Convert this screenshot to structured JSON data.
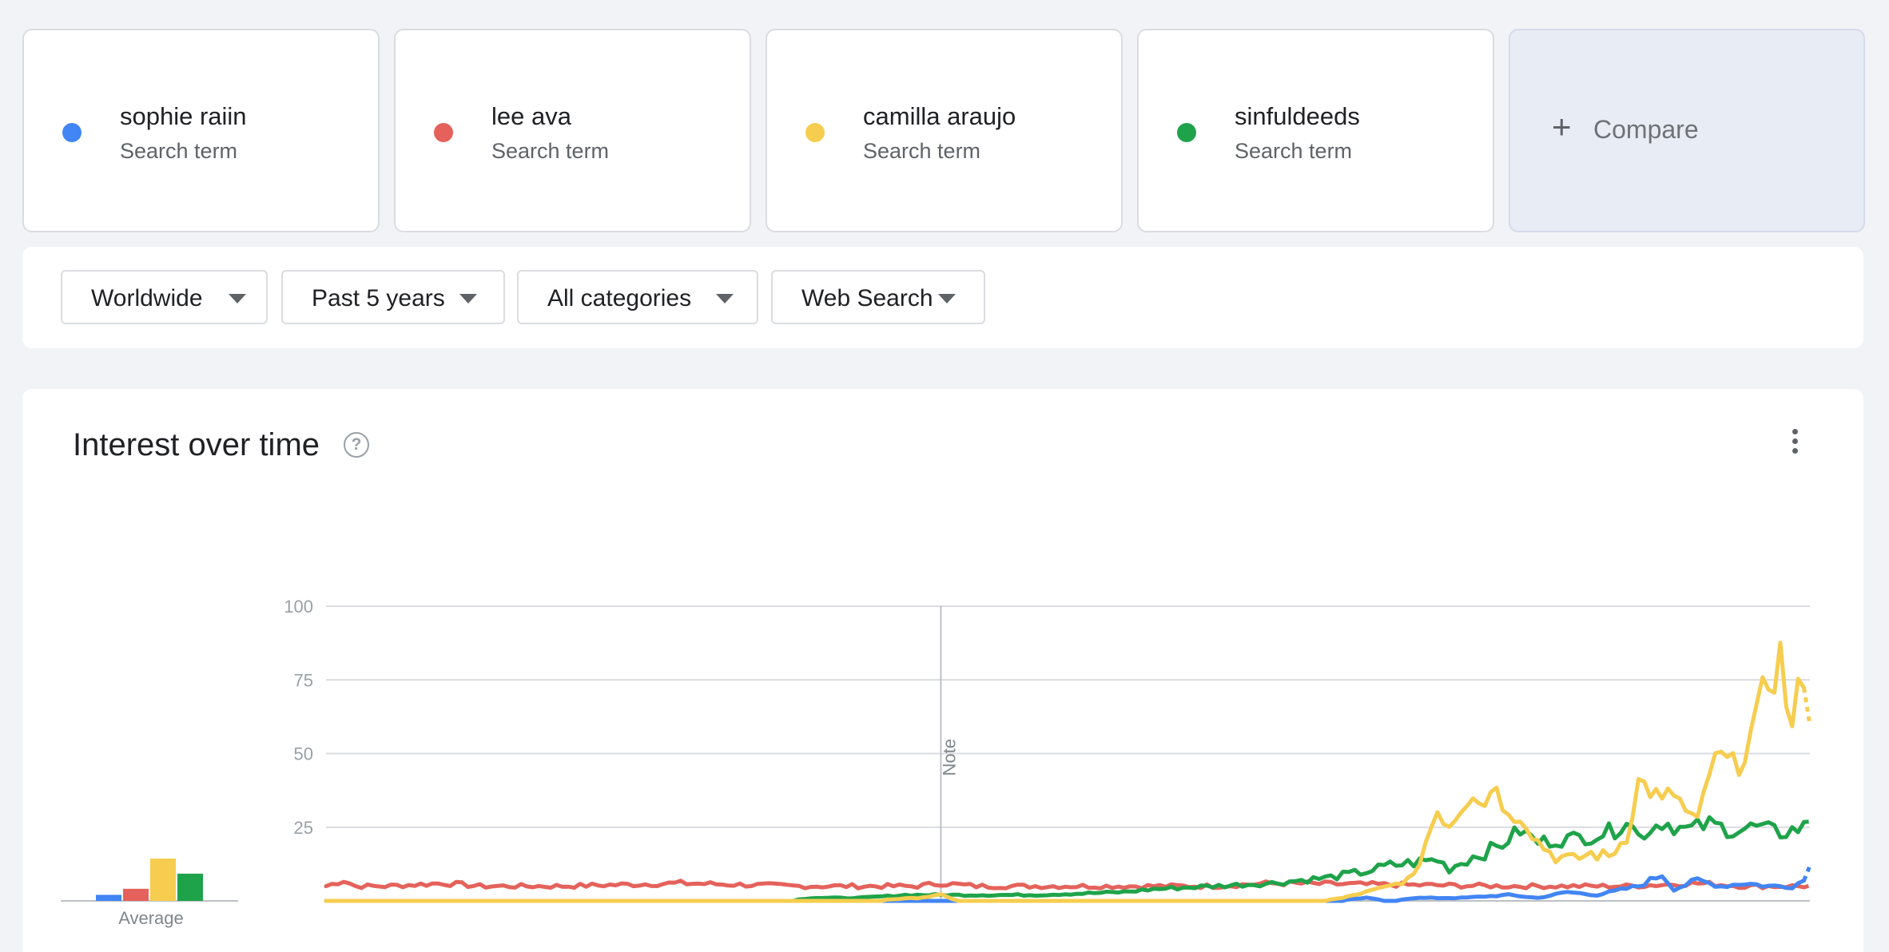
{
  "terms": [
    {
      "name": "sophie raiin",
      "subtitle": "Search term",
      "color": "#4285f4"
    },
    {
      "name": "lee ava",
      "subtitle": "Search term",
      "color": "#e4625b"
    },
    {
      "name": "camilla araujo",
      "subtitle": "Search term",
      "color": "#f6cd4f"
    },
    {
      "name": "sinfuldeeds",
      "subtitle": "Search term",
      "color": "#1fa34a"
    }
  ],
  "compare": {
    "icon": "plus-icon",
    "label": "Compare"
  },
  "filters": [
    {
      "label": "Worldwide"
    },
    {
      "label": "Past 5 years"
    },
    {
      "label": "All categories"
    },
    {
      "label": "Web Search"
    }
  ],
  "panel": {
    "title": "Interest over time",
    "help_icon": "?",
    "menu_icon": "more-vert-icon",
    "average_label": "Average",
    "note_label": "Note"
  },
  "chart_data": {
    "type": "line",
    "title": "",
    "xlabel": "",
    "ylabel": "",
    "ylim": [
      0,
      100
    ],
    "yticks": [
      25,
      50,
      75,
      100
    ],
    "ytick_labels": [
      "25",
      "50",
      "75",
      "100"
    ],
    "grid": true,
    "note_marker_week": 104,
    "weeks": 252,
    "partial_last_point": true,
    "averages": [
      {
        "name": "sophie raiin",
        "value": 2
      },
      {
        "name": "lee ava",
        "value": 4
      },
      {
        "name": "camilla araujo",
        "value": 14
      },
      {
        "name": "sinfuldeeds",
        "value": 9
      }
    ],
    "series": [
      {
        "name": "sophie raiin",
        "color": "#4285f4",
        "keypoints": [
          [
            0,
            0
          ],
          [
            150,
            0
          ],
          [
            160,
            0
          ],
          [
            170,
            0
          ],
          [
            176,
            1
          ],
          [
            180,
            0
          ],
          [
            184,
            1
          ],
          [
            192,
            1
          ],
          [
            200,
            2
          ],
          [
            205,
            1
          ],
          [
            210,
            3
          ],
          [
            215,
            2
          ],
          [
            222,
            5
          ],
          [
            226,
            9
          ],
          [
            228,
            4
          ],
          [
            232,
            7
          ],
          [
            236,
            5
          ],
          [
            240,
            6
          ],
          [
            244,
            5
          ],
          [
            248,
            5
          ],
          [
            250,
            7
          ],
          [
            251,
            14
          ]
        ]
      },
      {
        "name": "lee ava",
        "color": "#e4625b",
        "keypoints": [
          [
            0,
            5
          ],
          [
            3,
            7
          ],
          [
            5,
            5
          ],
          [
            10,
            5
          ],
          [
            20,
            6
          ],
          [
            26,
            5
          ],
          [
            40,
            5
          ],
          [
            60,
            6
          ],
          [
            80,
            5
          ],
          [
            100,
            5
          ],
          [
            104,
            6
          ],
          [
            110,
            5
          ],
          [
            140,
            5
          ],
          [
            150,
            5
          ],
          [
            160,
            6
          ],
          [
            200,
            5
          ],
          [
            220,
            5
          ],
          [
            232,
            6
          ],
          [
            240,
            5
          ],
          [
            251,
            5
          ]
        ]
      },
      {
        "name": "camilla araujo",
        "color": "#f6cd4f",
        "keypoints": [
          [
            0,
            0
          ],
          [
            90,
            0
          ],
          [
            100,
            1
          ],
          [
            104,
            2
          ],
          [
            107,
            0
          ],
          [
            115,
            0
          ],
          [
            130,
            0
          ],
          [
            140,
            0
          ],
          [
            150,
            0
          ],
          [
            168,
            0
          ],
          [
            172,
            1
          ],
          [
            176,
            3
          ],
          [
            180,
            5
          ],
          [
            184,
            8
          ],
          [
            186,
            20
          ],
          [
            188,
            31
          ],
          [
            190,
            26
          ],
          [
            194,
            38
          ],
          [
            196,
            34
          ],
          [
            198,
            40
          ],
          [
            200,
            28
          ],
          [
            202,
            30
          ],
          [
            205,
            20
          ],
          [
            208,
            15
          ],
          [
            211,
            14
          ],
          [
            214,
            16
          ],
          [
            217,
            15
          ],
          [
            220,
            22
          ],
          [
            222,
            40
          ],
          [
            224,
            38
          ],
          [
            226,
            33
          ],
          [
            228,
            37
          ],
          [
            230,
            30
          ],
          [
            232,
            26
          ],
          [
            234,
            44
          ],
          [
            236,
            48
          ],
          [
            238,
            45
          ],
          [
            240,
            52
          ],
          [
            242,
            60
          ],
          [
            244,
            76
          ],
          [
            246,
            82
          ],
          [
            248,
            57
          ],
          [
            250,
            80
          ],
          [
            251,
            64
          ]
        ]
      },
      {
        "name": "sinfuldeeds",
        "color": "#1fa34a",
        "keypoints": [
          [
            0,
            0
          ],
          [
            60,
            0
          ],
          [
            78,
            0
          ],
          [
            82,
            1
          ],
          [
            90,
            1
          ],
          [
            98,
            2
          ],
          [
            106,
            2
          ],
          [
            120,
            2
          ],
          [
            135,
            3
          ],
          [
            140,
            4
          ],
          [
            150,
            5
          ],
          [
            160,
            6
          ],
          [
            170,
            8
          ],
          [
            176,
            10
          ],
          [
            180,
            12
          ],
          [
            184,
            13
          ],
          [
            188,
            14
          ],
          [
            190,
            11
          ],
          [
            194,
            15
          ],
          [
            198,
            18
          ],
          [
            202,
            24
          ],
          [
            205,
            20
          ],
          [
            210,
            21
          ],
          [
            214,
            22
          ],
          [
            218,
            24
          ],
          [
            220,
            28
          ],
          [
            222,
            22
          ],
          [
            226,
            27
          ],
          [
            230,
            24
          ],
          [
            234,
            26
          ],
          [
            238,
            24
          ],
          [
            242,
            25
          ],
          [
            246,
            23
          ],
          [
            250,
            25
          ],
          [
            251,
            28
          ]
        ]
      }
    ]
  }
}
